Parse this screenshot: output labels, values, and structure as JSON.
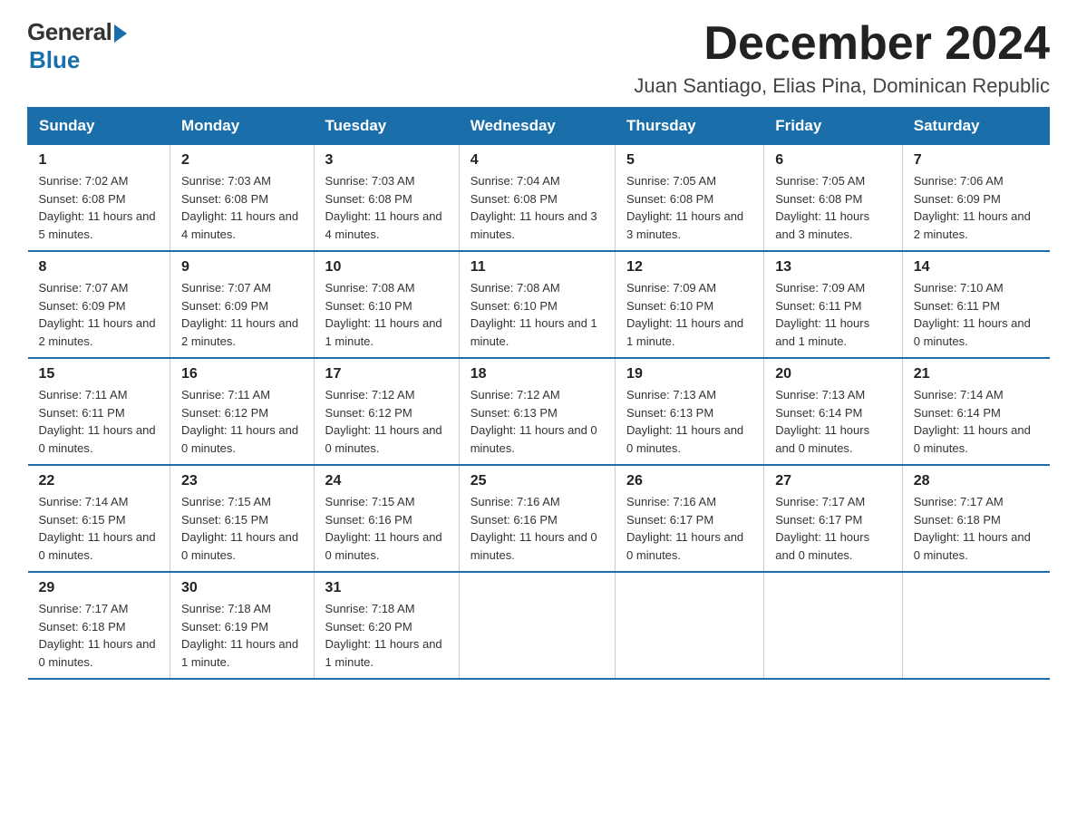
{
  "header": {
    "logo_general": "General",
    "logo_blue": "Blue",
    "month_title": "December 2024",
    "location": "Juan Santiago, Elias Pina, Dominican Republic"
  },
  "days_of_week": [
    "Sunday",
    "Monday",
    "Tuesday",
    "Wednesday",
    "Thursday",
    "Friday",
    "Saturday"
  ],
  "weeks": [
    [
      {
        "day": "1",
        "sunrise": "7:02 AM",
        "sunset": "6:08 PM",
        "daylight": "11 hours and 5 minutes."
      },
      {
        "day": "2",
        "sunrise": "7:03 AM",
        "sunset": "6:08 PM",
        "daylight": "11 hours and 4 minutes."
      },
      {
        "day": "3",
        "sunrise": "7:03 AM",
        "sunset": "6:08 PM",
        "daylight": "11 hours and 4 minutes."
      },
      {
        "day": "4",
        "sunrise": "7:04 AM",
        "sunset": "6:08 PM",
        "daylight": "11 hours and 3 minutes."
      },
      {
        "day": "5",
        "sunrise": "7:05 AM",
        "sunset": "6:08 PM",
        "daylight": "11 hours and 3 minutes."
      },
      {
        "day": "6",
        "sunrise": "7:05 AM",
        "sunset": "6:08 PM",
        "daylight": "11 hours and 3 minutes."
      },
      {
        "day": "7",
        "sunrise": "7:06 AM",
        "sunset": "6:09 PM",
        "daylight": "11 hours and 2 minutes."
      }
    ],
    [
      {
        "day": "8",
        "sunrise": "7:07 AM",
        "sunset": "6:09 PM",
        "daylight": "11 hours and 2 minutes."
      },
      {
        "day": "9",
        "sunrise": "7:07 AM",
        "sunset": "6:09 PM",
        "daylight": "11 hours and 2 minutes."
      },
      {
        "day": "10",
        "sunrise": "7:08 AM",
        "sunset": "6:10 PM",
        "daylight": "11 hours and 1 minute."
      },
      {
        "day": "11",
        "sunrise": "7:08 AM",
        "sunset": "6:10 PM",
        "daylight": "11 hours and 1 minute."
      },
      {
        "day": "12",
        "sunrise": "7:09 AM",
        "sunset": "6:10 PM",
        "daylight": "11 hours and 1 minute."
      },
      {
        "day": "13",
        "sunrise": "7:09 AM",
        "sunset": "6:11 PM",
        "daylight": "11 hours and 1 minute."
      },
      {
        "day": "14",
        "sunrise": "7:10 AM",
        "sunset": "6:11 PM",
        "daylight": "11 hours and 0 minutes."
      }
    ],
    [
      {
        "day": "15",
        "sunrise": "7:11 AM",
        "sunset": "6:11 PM",
        "daylight": "11 hours and 0 minutes."
      },
      {
        "day": "16",
        "sunrise": "7:11 AM",
        "sunset": "6:12 PM",
        "daylight": "11 hours and 0 minutes."
      },
      {
        "day": "17",
        "sunrise": "7:12 AM",
        "sunset": "6:12 PM",
        "daylight": "11 hours and 0 minutes."
      },
      {
        "day": "18",
        "sunrise": "7:12 AM",
        "sunset": "6:13 PM",
        "daylight": "11 hours and 0 minutes."
      },
      {
        "day": "19",
        "sunrise": "7:13 AM",
        "sunset": "6:13 PM",
        "daylight": "11 hours and 0 minutes."
      },
      {
        "day": "20",
        "sunrise": "7:13 AM",
        "sunset": "6:14 PM",
        "daylight": "11 hours and 0 minutes."
      },
      {
        "day": "21",
        "sunrise": "7:14 AM",
        "sunset": "6:14 PM",
        "daylight": "11 hours and 0 minutes."
      }
    ],
    [
      {
        "day": "22",
        "sunrise": "7:14 AM",
        "sunset": "6:15 PM",
        "daylight": "11 hours and 0 minutes."
      },
      {
        "day": "23",
        "sunrise": "7:15 AM",
        "sunset": "6:15 PM",
        "daylight": "11 hours and 0 minutes."
      },
      {
        "day": "24",
        "sunrise": "7:15 AM",
        "sunset": "6:16 PM",
        "daylight": "11 hours and 0 minutes."
      },
      {
        "day": "25",
        "sunrise": "7:16 AM",
        "sunset": "6:16 PM",
        "daylight": "11 hours and 0 minutes."
      },
      {
        "day": "26",
        "sunrise": "7:16 AM",
        "sunset": "6:17 PM",
        "daylight": "11 hours and 0 minutes."
      },
      {
        "day": "27",
        "sunrise": "7:17 AM",
        "sunset": "6:17 PM",
        "daylight": "11 hours and 0 minutes."
      },
      {
        "day": "28",
        "sunrise": "7:17 AM",
        "sunset": "6:18 PM",
        "daylight": "11 hours and 0 minutes."
      }
    ],
    [
      {
        "day": "29",
        "sunrise": "7:17 AM",
        "sunset": "6:18 PM",
        "daylight": "11 hours and 0 minutes."
      },
      {
        "day": "30",
        "sunrise": "7:18 AM",
        "sunset": "6:19 PM",
        "daylight": "11 hours and 1 minute."
      },
      {
        "day": "31",
        "sunrise": "7:18 AM",
        "sunset": "6:20 PM",
        "daylight": "11 hours and 1 minute."
      },
      null,
      null,
      null,
      null
    ]
  ]
}
